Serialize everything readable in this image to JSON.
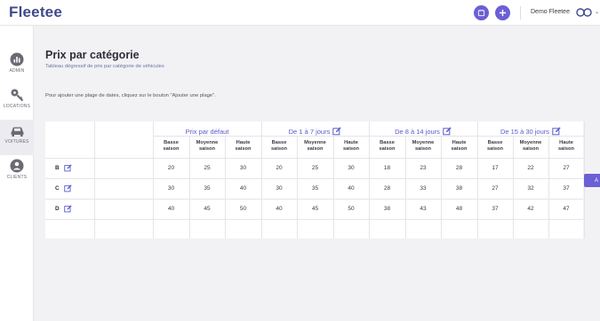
{
  "app": {
    "logo": "Fleetee"
  },
  "header": {
    "username": "Demo Fleetee"
  },
  "sidebar": {
    "items": [
      {
        "label": "ADMIN",
        "icon": "chart-icon"
      },
      {
        "label": "LOCATIONS",
        "icon": "key-icon"
      },
      {
        "label": "VOITURES",
        "icon": "car-icon",
        "active": true
      },
      {
        "label": "CLIENTS",
        "icon": "user-icon"
      }
    ]
  },
  "page": {
    "title": "Prix par catégorie",
    "subtitle": "Tableau dégressif de prix par catégorie de véhicules",
    "hint": "Pour ajouter une plage de dates, cliquez sur le bouton \"Ajouter une plage\".",
    "add_button": "A"
  },
  "table": {
    "groups": [
      "Prix par défaut",
      "De 1 à 7 jours",
      "De 8 à 14 jours",
      "De 15 à 30 jours"
    ],
    "seasons": [
      [
        "Basse",
        "saison"
      ],
      [
        "Moyenne",
        "saison"
      ],
      [
        "Haute",
        "saison"
      ]
    ],
    "rows": [
      {
        "label": "B",
        "values": [
          "20",
          "25",
          "30",
          "20",
          "25",
          "30",
          "18",
          "23",
          "28",
          "17",
          "22",
          "27"
        ]
      },
      {
        "label": "C",
        "values": [
          "30",
          "35",
          "40",
          "30",
          "35",
          "40",
          "28",
          "33",
          "38",
          "27",
          "32",
          "37"
        ]
      },
      {
        "label": "D",
        "values": [
          "40",
          "45",
          "50",
          "40",
          "45",
          "50",
          "38",
          "43",
          "48",
          "37",
          "42",
          "47"
        ]
      }
    ]
  },
  "colors": {
    "accent": "#6b5fd6",
    "brand": "#3f4a8a"
  }
}
